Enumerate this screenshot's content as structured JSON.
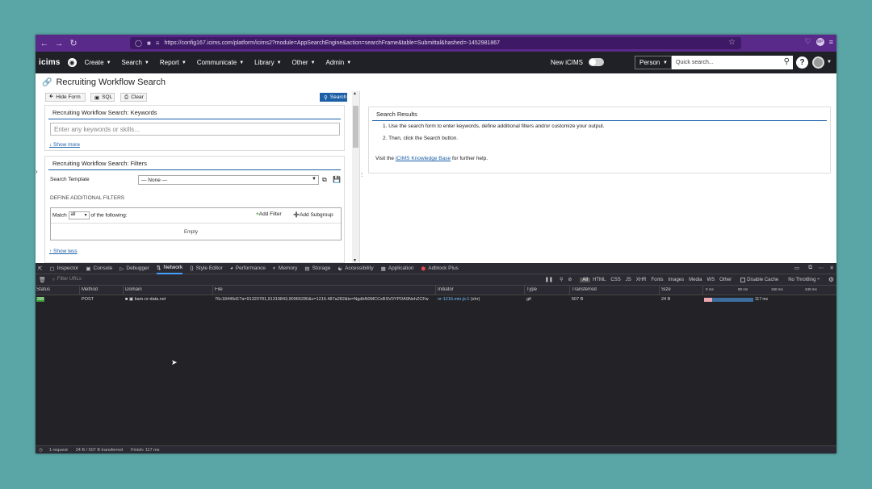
{
  "browser": {
    "url": "https://config167.icims.com/platform/icims2?module=AppSearchEngine&action=searchFrame&table=Submittal&hashed=-1452981867",
    "profile": "MP"
  },
  "appnav": {
    "logo": "icims",
    "menus": [
      "Create",
      "Search",
      "Report",
      "Communicate",
      "Library",
      "Other",
      "Admin"
    ],
    "new_icims_label": "New iCIMS",
    "search_scope": "Person",
    "quick_search_placeholder": "Quick search...",
    "help": "?"
  },
  "page": {
    "title": "Recruiting Workflow Search",
    "buttons": {
      "hide_form": "Hide Form",
      "sql": "SQL",
      "clear": "Clear",
      "search": "Search"
    },
    "keywords_panel": {
      "title": "Recruiting Workflow Search: Keywords",
      "placeholder": "Enter any keywords or skills...",
      "show_more": "↓ Show more"
    },
    "filters_panel": {
      "title": "Recruiting Workflow Search: Filters",
      "template_label": "Search Template",
      "template_value": "— None —",
      "define_label": "DEFINE ADDITIONAL FILTERS",
      "match_prefix": "Match",
      "match_value": "all",
      "match_suffix": "of the following:",
      "add_filter": "Add Filter",
      "add_subgroup": "Add Subgroup",
      "empty": "Empty",
      "show_less": "↑ Show less"
    },
    "results": {
      "title": "Search Results",
      "step1": "1. Use the search form to enter keywords, define additional filters and/or customize your output.",
      "step2": "2. Then, click the Search button.",
      "visit_prefix": "Visit the",
      "kb_link": "iCIMS Knowledge Base",
      "visit_suffix": "for further help."
    }
  },
  "devtools": {
    "tabs": [
      "Inspector",
      "Console",
      "Debugger",
      "Network",
      "Style Editor",
      "Performance",
      "Memory",
      "Storage",
      "Accessibility",
      "Application",
      "Adblock Plus"
    ],
    "active_tab": "Network",
    "filter_placeholder": "Filter URLs",
    "type_filters": [
      "All",
      "HTML",
      "CSS",
      "JS",
      "XHR",
      "Fonts",
      "Images",
      "Media",
      "WS",
      "Other"
    ],
    "disable_cache": "Disable Cache",
    "throttling": "No Throttling ÷",
    "columns": [
      "Status",
      "Method",
      "Domain",
      "File",
      "Initiator",
      "Type",
      "Transferred",
      "Size"
    ],
    "timeline_ticks": [
      "0 ms",
      "80 ms",
      "160 ms",
      "240 ms"
    ],
    "request": {
      "status": "200",
      "method": "POST",
      "domain": "bam.nr-data.net",
      "file": "76c18446d1?a=91320781,91319843,90966280&v=1216.487a282&to=NgdbN0MCCxBSV0YPDA9NehZCFw",
      "initiator": "nr-1216.min.js:1",
      "initiator_suffix": "(xhr)",
      "type": "gif",
      "transferred": "507 B",
      "size": "24 B",
      "timing": "117 ms"
    },
    "status_bar": {
      "requests": "1 request",
      "transferred": "24 B / 507 B transferred",
      "finish": "Finish: 117 ms"
    }
  }
}
